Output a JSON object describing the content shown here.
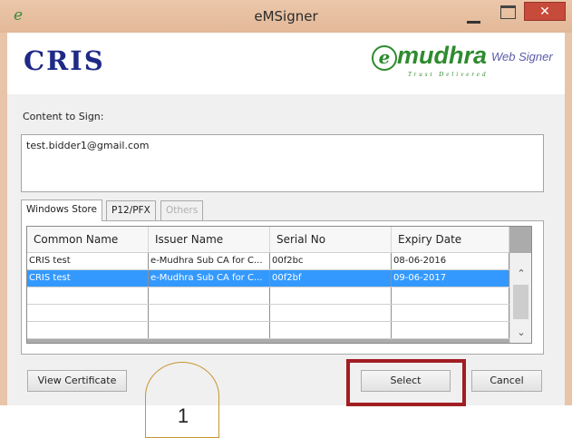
{
  "window": {
    "title": "eMSigner",
    "app_icon": "e",
    "close_glyph": "✕"
  },
  "header": {
    "left_logo": "CRIS",
    "right_logo": {
      "mark": "e",
      "name": "mudhra",
      "tagline": "Trust Delivered",
      "product": "Web Signer"
    }
  },
  "content": {
    "label": "Content to Sign:",
    "value": "test.bidder1@gmail.com"
  },
  "tabs": [
    {
      "label": "Windows Store",
      "active": true,
      "enabled": true
    },
    {
      "label": "P12/PFX",
      "active": false,
      "enabled": true
    },
    {
      "label": "Others",
      "active": false,
      "enabled": false
    }
  ],
  "table": {
    "columns": [
      "Common Name",
      "Issuer Name",
      "Serial No",
      "Expiry Date"
    ],
    "rows": [
      {
        "common_name": "CRIS test",
        "issuer": "e-Mudhra Sub CA for C...",
        "serial": "00f2bc",
        "expiry": "08-06-2016",
        "selected": false
      },
      {
        "common_name": "CRIS test",
        "issuer": "e-Mudhra Sub CA for C...",
        "serial": "00f2bf",
        "expiry": "09-06-2017",
        "selected": true
      },
      {
        "common_name": "",
        "issuer": "",
        "serial": "",
        "expiry": "",
        "selected": false
      },
      {
        "common_name": "",
        "issuer": "",
        "serial": "",
        "expiry": "",
        "selected": false
      },
      {
        "common_name": "",
        "issuer": "",
        "serial": "",
        "expiry": "",
        "selected": false
      }
    ]
  },
  "buttons": {
    "view_certificate": "View Certificate",
    "select": "Select",
    "cancel": "Cancel"
  },
  "annotation": {
    "callout_number": "1"
  },
  "colors": {
    "titlebar": "#e8c4a8",
    "selection": "#3399ff",
    "highlight": "#a11e22",
    "brand_green": "#2e8b2e",
    "cris_blue": "#1e2a86"
  }
}
